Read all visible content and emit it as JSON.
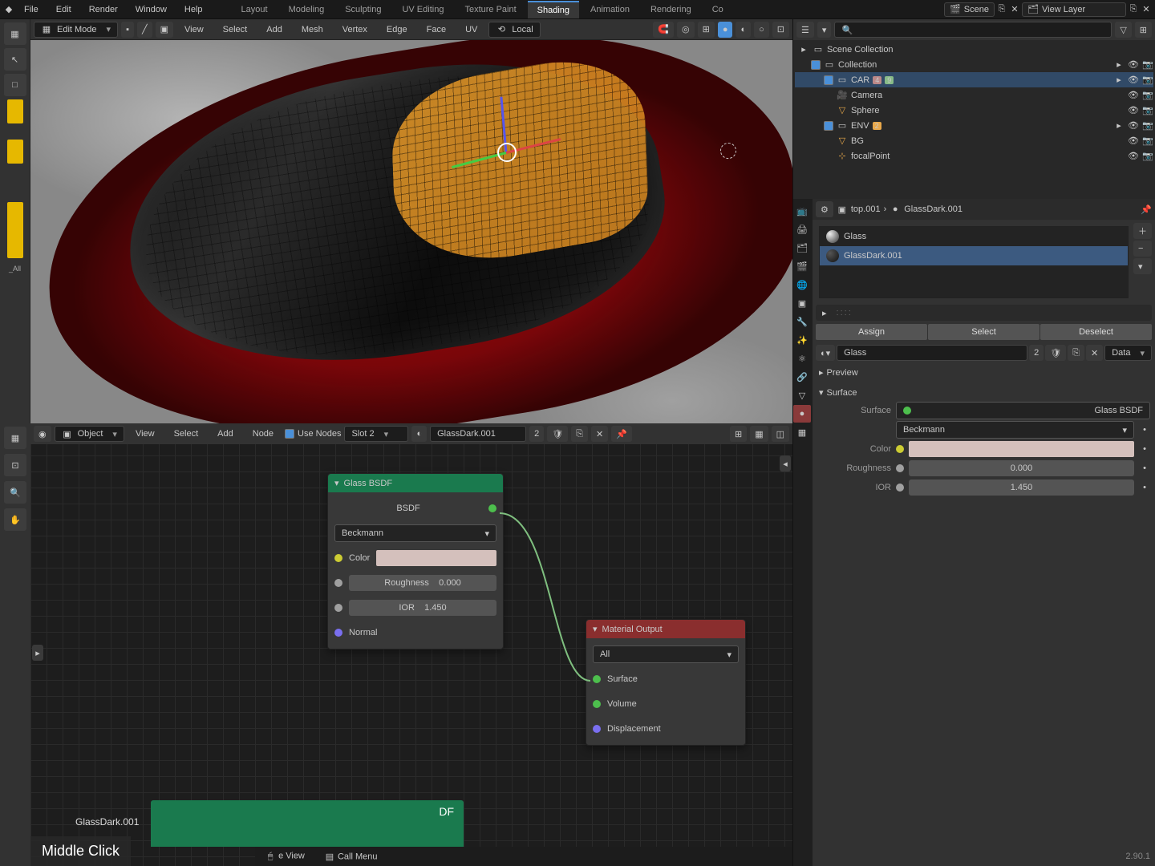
{
  "topmenu": [
    "File",
    "Edit",
    "Render",
    "Window",
    "Help"
  ],
  "workspaces": [
    "Layout",
    "Modeling",
    "Sculpting",
    "UV Editing",
    "Texture Paint",
    "Shading",
    "Animation",
    "Rendering",
    "Co"
  ],
  "workspace_active": 5,
  "scene_label": "Scene",
  "viewlayer_label": "View Layer",
  "viewport": {
    "mode": "Edit Mode",
    "menus": [
      "View",
      "Select",
      "Add",
      "Mesh",
      "Vertex",
      "Edge",
      "Face",
      "UV"
    ],
    "orient": "Local"
  },
  "node_editor": {
    "mode": "Object",
    "menus": [
      "View",
      "Select",
      "Add",
      "Node"
    ],
    "use_nodes": "Use Nodes",
    "slot": "Slot 2",
    "slot_index": "2",
    "material": "GlassDark.001"
  },
  "glass_node": {
    "title": "Glass BSDF",
    "bsdf": "BSDF",
    "distribution": "Beckmann",
    "color": "Color",
    "roughness": "Roughness",
    "roughness_val": "0.000",
    "ior": "IOR",
    "ior_val": "1.450",
    "normal": "Normal"
  },
  "mat_output": {
    "title": "Material Output",
    "target": "All",
    "surface": "Surface",
    "volume": "Volume",
    "displacement": "Displacement"
  },
  "cut_node_suffix": "DF",
  "bottom_label": "GlassDark.001",
  "hint": "Middle Click",
  "footer": {
    "view": "e View",
    "call": "Call Menu"
  },
  "outliner": {
    "root": "Scene Collection",
    "items": [
      {
        "chk": true,
        "name": "Collection",
        "lvl": 1
      },
      {
        "chk": true,
        "name": "CAR",
        "lvl": 2,
        "badges": [
          "4",
          "9"
        ]
      },
      {
        "name": "Camera",
        "lvl": 3,
        "cam": true
      },
      {
        "name": "Sphere",
        "lvl": 3
      },
      {
        "chk": true,
        "name": "ENV",
        "lvl": 2,
        "badges": [
          "2"
        ]
      },
      {
        "name": "BG",
        "lvl": 3
      },
      {
        "name": "focalPoint",
        "lvl": 3
      }
    ]
  },
  "props": {
    "breadcrumb": [
      "top.001",
      "GlassDark.001"
    ],
    "mat_list": [
      "Glass",
      "GlassDark.001"
    ],
    "mat_selected": 1,
    "assign": "Assign",
    "select": "Select",
    "deselect": "Deselect",
    "mat_btn": "Glass",
    "mat_idx": "2",
    "data": "Data",
    "preview": "Preview",
    "surface": "Surface",
    "surf_label": "Surface",
    "surf_val": "Glass BSDF",
    "dist_val": "Beckmann",
    "color": "Color",
    "rough": "Roughness",
    "rough_val": "0.000",
    "ior": "IOR",
    "ior_val": "1.450"
  },
  "version": "2.90.1"
}
